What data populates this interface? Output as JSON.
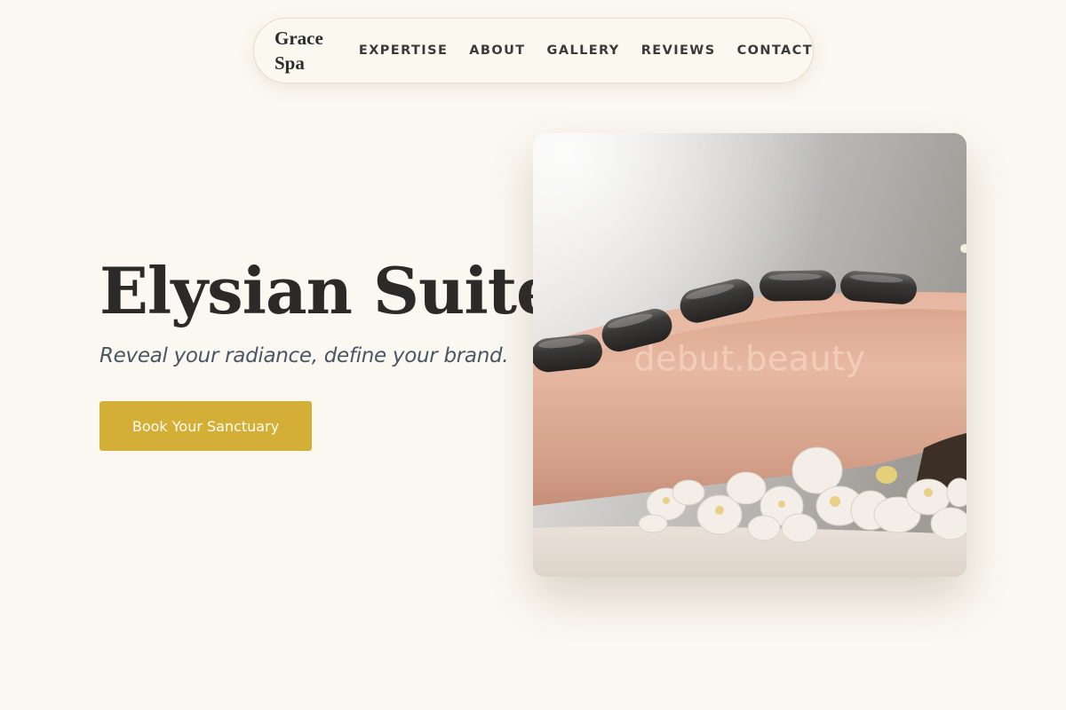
{
  "nav": {
    "brand": "Grace Spa",
    "links": [
      "EXPERTISE",
      "ABOUT",
      "GALLERY",
      "REVIEWS",
      "CONTACT"
    ]
  },
  "hero": {
    "title": "Elysian Suite",
    "subtitle": "Reveal your radiance, define your brand.",
    "cta_label": "Book Your Sanctuary",
    "image_watermark": "debut.beauty"
  },
  "colors": {
    "background": "#fbf8f1",
    "accent": "#d4af37",
    "title": "#2b2a28",
    "subtitle": "#4a5663"
  }
}
